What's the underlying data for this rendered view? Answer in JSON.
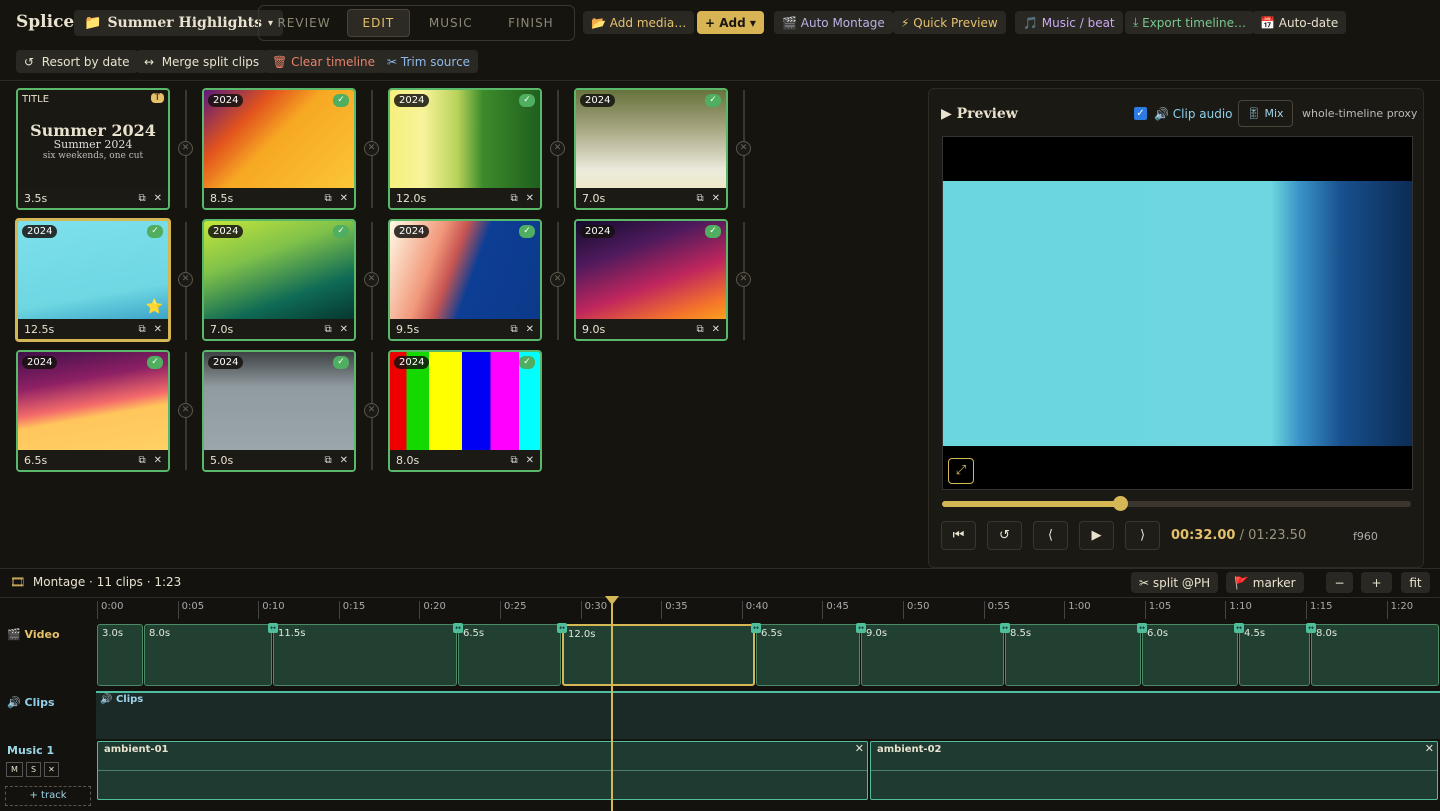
{
  "app": {
    "name": "Splice",
    "project": "Summer Highlights"
  },
  "modes": [
    "REVIEW",
    "EDIT",
    "MUSIC",
    "FINISH"
  ],
  "active_mode": "EDIT",
  "toolbar": {
    "add_media": "Add media…",
    "add": "Add",
    "auto_montage": "Auto Montage",
    "quick_preview": "Quick Preview",
    "music_beat": "Music / beat",
    "export": "Export timeline…",
    "auto_date": "Auto-date"
  },
  "toolbar2": {
    "resort": "Resort by date",
    "merge": "Merge split clips",
    "clear": "Clear timeline",
    "trim": "Trim source"
  },
  "title_card": {
    "badge": "TITLE",
    "title": "Summer 2024",
    "sub": "six weekends, one cut",
    "dur": "3.5s"
  },
  "cards": [
    {
      "yr": "2024",
      "dur": "8.5s"
    },
    {
      "yr": "2024",
      "dur": "12.0s"
    },
    {
      "yr": "2024",
      "dur": "7.0s"
    },
    {
      "yr": "2024",
      "dur": "12.5s"
    },
    {
      "yr": "2024",
      "dur": "7.0s"
    },
    {
      "yr": "2024",
      "dur": "9.5s"
    },
    {
      "yr": "2024",
      "dur": "9.0s"
    },
    {
      "yr": "2024",
      "dur": "6.5s"
    },
    {
      "yr": "2024",
      "dur": "5.0s"
    },
    {
      "yr": "2024",
      "dur": "8.0s"
    }
  ],
  "preview": {
    "title": "Preview",
    "clip_audio": "Clip audio",
    "mix": "Mix",
    "proxy": "whole-timeline proxy",
    "time": "00:32.00",
    "total": "/ 01:23.50",
    "frame": "f960",
    "progress": 0.38
  },
  "timeline": {
    "summary": "Montage · 11 clips · 1:23",
    "split": "split @PH",
    "marker": "marker",
    "zoom_out": "−",
    "zoom_in": "+",
    "fit": "fit",
    "ticks": [
      "0:00",
      "0:05",
      "0:10",
      "0:15",
      "0:20",
      "0:25",
      "0:30",
      "0:35",
      "0:40",
      "0:45",
      "0:50",
      "0:55",
      "1:00",
      "1:05",
      "1:10",
      "1:15",
      "1:20"
    ],
    "video_label": "Video",
    "clips_label": "Clips",
    "music_label": "Music 1",
    "add_track": "+ track",
    "clips_track": "Clips",
    "clip_durs": [
      "3.0s",
      "8.0s",
      "11.5s",
      "6.5s",
      "12.0s",
      "6.5s",
      "9.0s",
      "8.5s",
      "6.0s",
      "4.5s",
      "8.0s"
    ],
    "music": [
      "ambient-01",
      "ambient-02"
    ],
    "msx": [
      "M",
      "S",
      "✕"
    ]
  }
}
